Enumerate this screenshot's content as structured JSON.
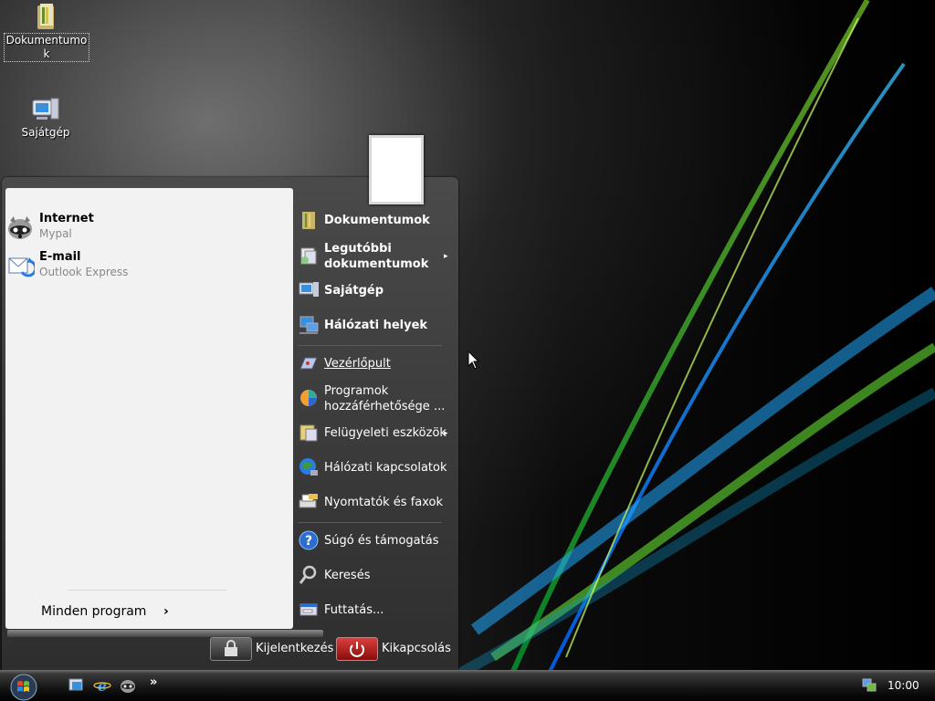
{
  "desktop": {
    "icons": [
      {
        "label": "Dokumentumo\nk",
        "icon": "documents-folder-icon"
      },
      {
        "label": "Sajátgép",
        "icon": "my-computer-icon"
      }
    ]
  },
  "start_menu": {
    "pinned": [
      {
        "title": "Internet",
        "subtitle": "Mypal",
        "icon": "raccoon-browser-icon"
      },
      {
        "title": "E-mail",
        "subtitle": "Outlook Express",
        "icon": "outlook-express-icon"
      }
    ],
    "all_programs": "Minden program",
    "all_programs_arrow": "›",
    "right_items": [
      {
        "label": "Dokumentumok",
        "bold": true,
        "icon": "documents-icon"
      },
      {
        "label": "Legutóbbi dokumentumok",
        "bold": true,
        "icon": "recent-documents-icon",
        "submenu": "▸"
      },
      {
        "label": "Sajátgép",
        "bold": true,
        "icon": "my-computer-icon"
      },
      {
        "label": "Hálózati helyek",
        "bold": true,
        "icon": "network-places-icon"
      },
      {
        "label": "Vezérlőpult",
        "icon": "control-panel-icon"
      },
      {
        "label": "Programok hozzáférhetősége ...",
        "icon": "program-access-icon"
      },
      {
        "label": "Felügyeleti eszközök",
        "icon": "admin-tools-icon",
        "submenu": "▸"
      },
      {
        "label": "Hálózati kapcsolatok",
        "icon": "network-connections-icon"
      },
      {
        "label": "Nyomtatók és faxok",
        "icon": "printers-faxes-icon"
      },
      {
        "label": "Súgó és támogatás",
        "icon": "help-icon"
      },
      {
        "label": "Keresés",
        "icon": "search-icon"
      },
      {
        "label": "Futtatás...",
        "icon": "run-icon"
      }
    ],
    "logoff": "Kijelentkezés",
    "shutdown": "Kikapcsolás"
  },
  "taskbar": {
    "quick_launch": [
      "show-desktop-icon",
      "ie-icon",
      "raccoon-browser-icon"
    ],
    "more": "»",
    "clock": "10:00"
  },
  "colors": {
    "menu_dark": "#2e2e2e",
    "left_pane": "#f2f2f2",
    "shutdown_red": "#c0201e"
  }
}
